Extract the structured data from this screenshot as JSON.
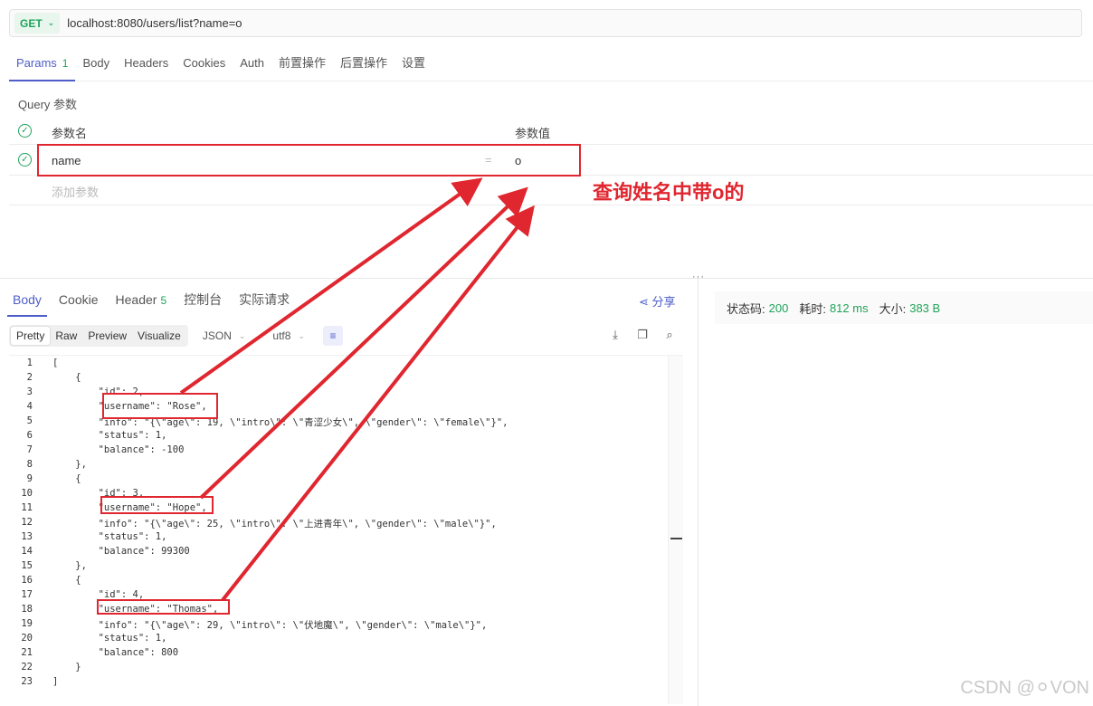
{
  "request": {
    "method": "GET",
    "url": "localhost:8080/users/list?name=o"
  },
  "req_tabs": [
    {
      "label": "Params",
      "count": "1"
    },
    {
      "label": "Body"
    },
    {
      "label": "Headers"
    },
    {
      "label": "Cookies"
    },
    {
      "label": "Auth"
    },
    {
      "label": "前置操作"
    },
    {
      "label": "后置操作"
    },
    {
      "label": "设置"
    }
  ],
  "params": {
    "section_title": "Query 参数",
    "col_name": "参数名",
    "col_value": "参数值",
    "row": {
      "name": "name",
      "eq": "=",
      "value": "o"
    },
    "add_placeholder": "添加参数"
  },
  "annotation": "查询姓名中带o的",
  "resp_tabs": [
    {
      "label": "Body"
    },
    {
      "label": "Cookie"
    },
    {
      "label": "Header",
      "count": "5"
    },
    {
      "label": "控制台"
    },
    {
      "label": "实际请求"
    }
  ],
  "share_label": "分享",
  "view_modes": [
    "Pretty",
    "Raw",
    "Preview",
    "Visualize"
  ],
  "format_select": "JSON",
  "encoding_select": "utf8",
  "status": {
    "code_label": "状态码:",
    "code": "200",
    "time_label": "耗时:",
    "time": "812 ms",
    "size_label": "大小:",
    "size": "383 B"
  },
  "code_lines": [
    "[",
    "    {",
    "        \"id\": 2,",
    "        \"username\": \"Rose\",",
    "        \"info\": \"{\\\"age\\\": 19, \\\"intro\\\": \\\"青涩少女\\\", \\\"gender\\\": \\\"female\\\"}\",",
    "        \"status\": 1,",
    "        \"balance\": -100",
    "    },",
    "    {",
    "        \"id\": 3,",
    "        \"username\": \"Hope\",",
    "        \"info\": \"{\\\"age\\\": 25, \\\"intro\\\": \\\"上进青年\\\", \\\"gender\\\": \\\"male\\\"}\",",
    "        \"status\": 1,",
    "        \"balance\": 99300",
    "    },",
    "    {",
    "        \"id\": 4,",
    "        \"username\": \"Thomas\",",
    "        \"info\": \"{\\\"age\\\": 29, \\\"intro\\\": \\\"伏地魔\\\", \\\"gender\\\": \\\"male\\\"}\",",
    "        \"status\": 1,",
    "        \"balance\": 800",
    "    }",
    "]"
  ],
  "watermark": "CSDN @⚪VON",
  "colors": {
    "accent": "#4e5ec9",
    "success": "#20a35a",
    "annotation": "#e0262f"
  }
}
